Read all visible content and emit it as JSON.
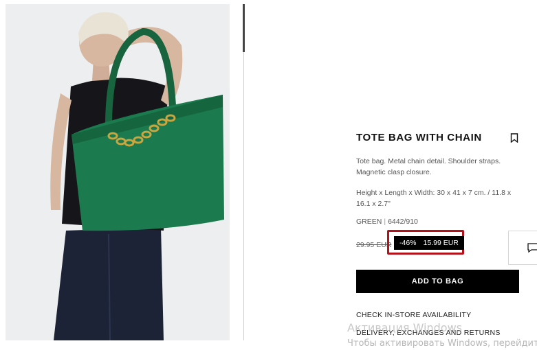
{
  "product": {
    "title": "TOTE BAG WITH CHAIN",
    "description": "Tote bag. Metal chain detail. Shoulder straps. Magnetic clasp closure.",
    "dimensions": "Height x Length x Width: 30 x 41 x 7 cm. / 11.8 x 16.1 x 2.7\"",
    "color": "GREEN",
    "ref": "6442/910",
    "old_price": "29.95 EUR",
    "discount": "-46%",
    "sale_price": "15.99 EUR",
    "add_to_bag": "ADD TO BAG",
    "check_store": "CHECK IN-STORE AVAILABILITY",
    "delivery": "DELIVERY, EXCHANGES AND RETURNS"
  },
  "watermark": {
    "line1": "Активация Windows",
    "line2": "Чтобы активировать Windows, перейдите"
  },
  "colors": {
    "bag": "#1b7a4e",
    "highlight": "#b3121a"
  },
  "icons": [
    "bookmark-icon",
    "chat-icon"
  ]
}
